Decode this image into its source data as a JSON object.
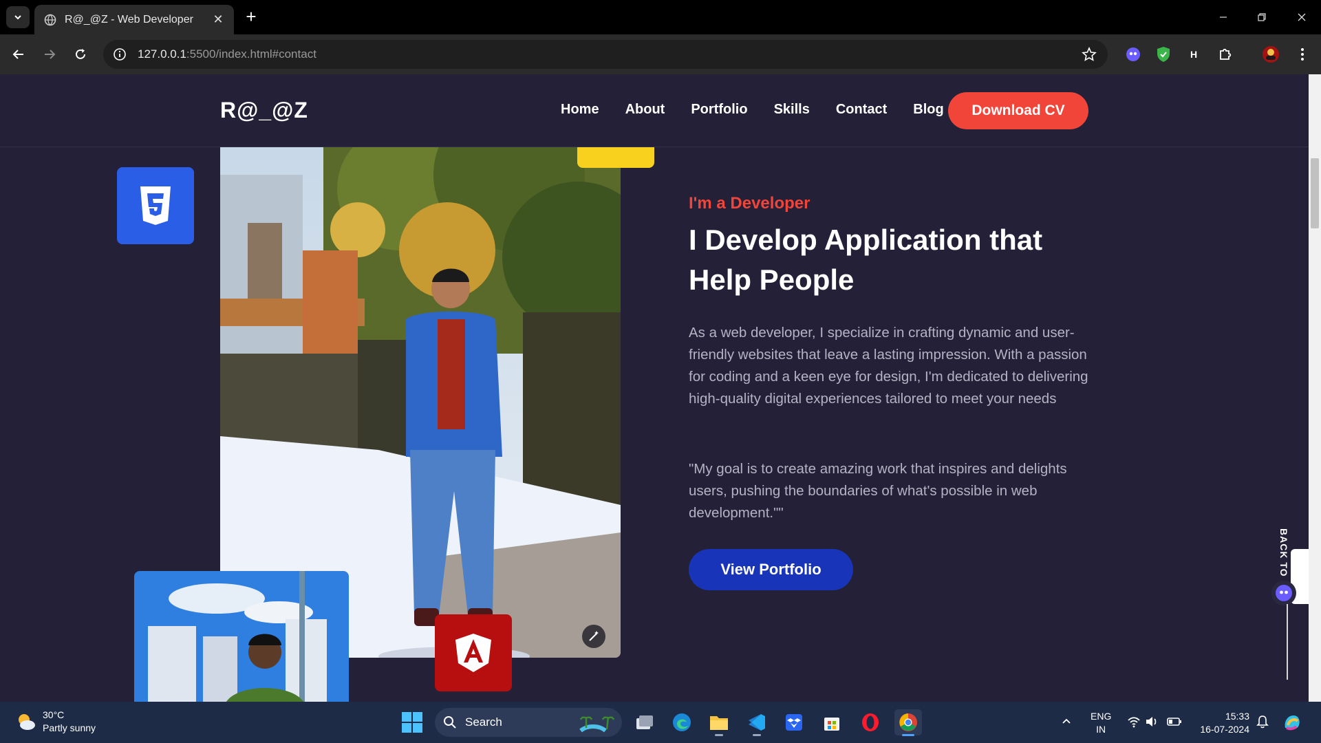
{
  "browser": {
    "tab_title": "R@_@Z - Web Developer",
    "url_host": "127.0.0.1",
    "url_rest": ":5500/index.html#contact",
    "new_tab": "+"
  },
  "site": {
    "logo": "R@_@Z",
    "menu": [
      "Home",
      "About",
      "Portfolio",
      "Skills",
      "Contact",
      "Blog"
    ],
    "cta": "Download CV",
    "eyebrow": "I'm a Developer",
    "headline": "I Develop Application that Help People",
    "paragraph": "As a web developer, I specialize in crafting dynamic and user-friendly websites that leave a lasting impression. With a passion for coding and a keen eye for design, I'm dedicated to delivering high-quality digital experiences tailored to meet your needs",
    "quote": "\"My goal is to create amazing work that inspires and delights users, pushing the boundaries of what's possible in web development.\"\"",
    "portfolio_button": "View Portfolio",
    "back_to_top": "BACK TO"
  },
  "colors": {
    "page_bg": "#232037",
    "accent": "#f2453a",
    "primary_button": "#1834b8",
    "css_badge": "#2b5ee6",
    "angular_badge": "#b70f0f",
    "yellow_tab": "#f7d11e"
  },
  "taskbar": {
    "weather_temp": "30°C",
    "weather_desc": "Partly sunny",
    "search_label": "Search",
    "lang_1": "ENG",
    "lang_2": "IN",
    "time": "15:33",
    "date": "16-07-2024"
  }
}
